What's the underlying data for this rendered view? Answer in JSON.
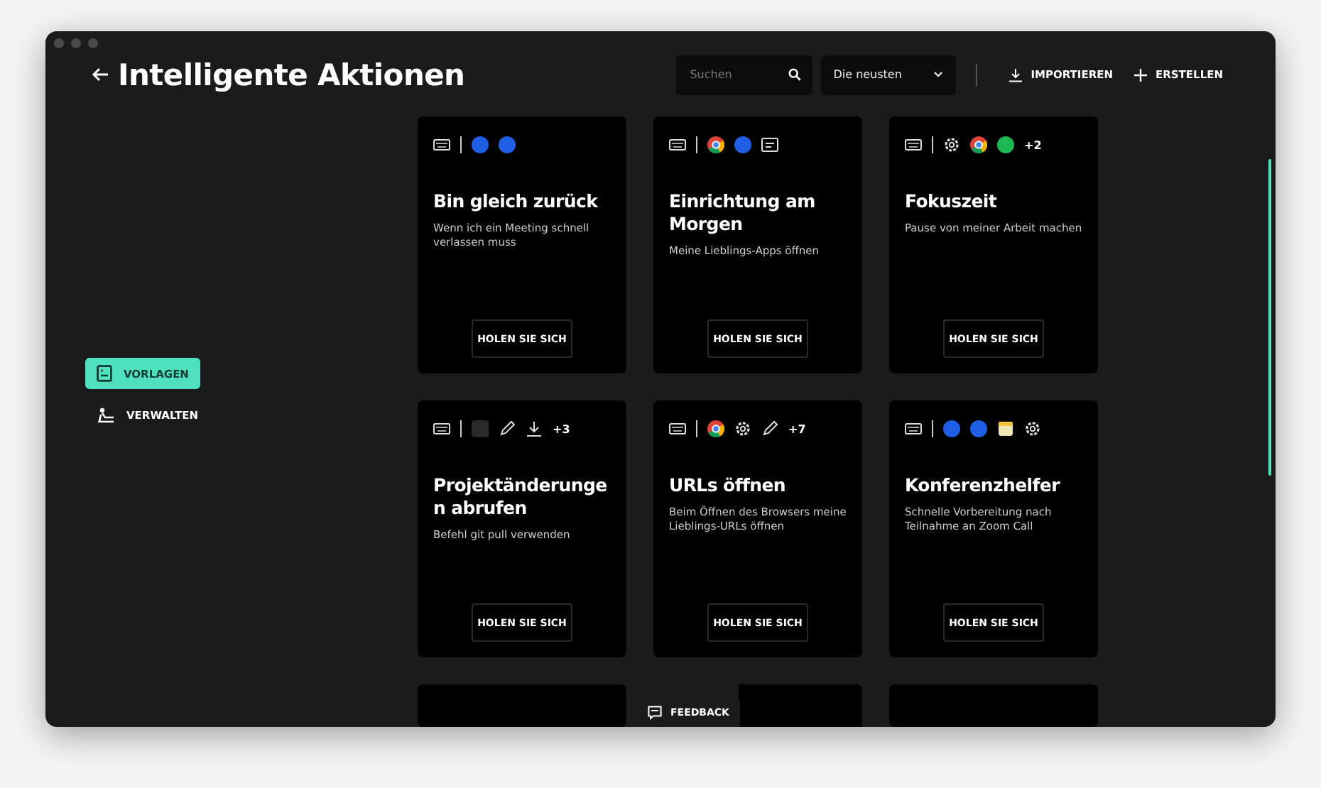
{
  "header": {
    "title": "Intelligente Aktionen",
    "search": {
      "placeholder": "Suchen"
    },
    "sort": {
      "value": "Die neusten"
    },
    "actions": [
      {
        "kind": "import",
        "label": "IMPORTIEREN"
      },
      {
        "kind": "create",
        "label": "ERSTELLEN"
      }
    ]
  },
  "sidebar": {
    "items": [
      {
        "kind": "templates",
        "label": "VORLAGEN",
        "selected": true
      },
      {
        "kind": "manage",
        "label": "VERWALTEN",
        "selected": false
      }
    ]
  },
  "cards": [
    {
      "title": "Bin gleich zurück",
      "description": "Wenn ich ein Meeting schnell verlassen muss",
      "button": "HOLEN SIE SICH",
      "icons": [
        {
          "kind": "keyboard"
        },
        {
          "kind": "separator"
        },
        {
          "kind": "round-app",
          "color": "#1f5fe6"
        },
        {
          "kind": "round-app",
          "color": "#1f5fe6"
        }
      ]
    },
    {
      "title": "Einrichtung am Morgen",
      "description": "Meine Lieblings-Apps öffnen",
      "button": "HOLEN SIE SICH",
      "icons": [
        {
          "kind": "keyboard"
        },
        {
          "kind": "separator"
        },
        {
          "kind": "browser"
        },
        {
          "kind": "round-app",
          "color": "#1f5fe6"
        },
        {
          "kind": "text-box"
        }
      ]
    },
    {
      "title": "Fokuszeit",
      "description": "Pause von meiner Arbeit machen",
      "button": "HOLEN SIE SICH",
      "icons": [
        {
          "kind": "keyboard"
        },
        {
          "kind": "separator"
        },
        {
          "kind": "gear"
        },
        {
          "kind": "browser"
        },
        {
          "kind": "round-app",
          "color": "#1db954"
        }
      ],
      "extra": "+2"
    },
    {
      "title": "Projektänderungen abrufen",
      "description": "Befehl git pull verwenden",
      "button": "HOLEN SIE SICH",
      "icons": [
        {
          "kind": "keyboard"
        },
        {
          "kind": "separator"
        },
        {
          "kind": "terminal"
        },
        {
          "kind": "pencil"
        },
        {
          "kind": "download"
        }
      ],
      "extra": "+3"
    },
    {
      "title": "URLs öffnen",
      "description": "Beim Öffnen des Browsers meine Lieblings-URLs öffnen",
      "button": "HOLEN SIE SICH",
      "icons": [
        {
          "kind": "keyboard"
        },
        {
          "kind": "separator"
        },
        {
          "kind": "browser"
        },
        {
          "kind": "gear"
        },
        {
          "kind": "pencil"
        }
      ],
      "extra": "+7"
    },
    {
      "title": "Konferenzhelfer",
      "description": "Schnelle Vorbereitung nach Teilnahme an Zoom Call",
      "button": "HOLEN SIE SICH",
      "icons": [
        {
          "kind": "keyboard"
        },
        {
          "kind": "separator"
        },
        {
          "kind": "round-app",
          "color": "#1f5fe6"
        },
        {
          "kind": "round-app",
          "color": "#1f5fe6"
        },
        {
          "kind": "note"
        },
        {
          "kind": "gear"
        }
      ]
    }
  ],
  "feedback": {
    "label": "FEEDBACK"
  }
}
